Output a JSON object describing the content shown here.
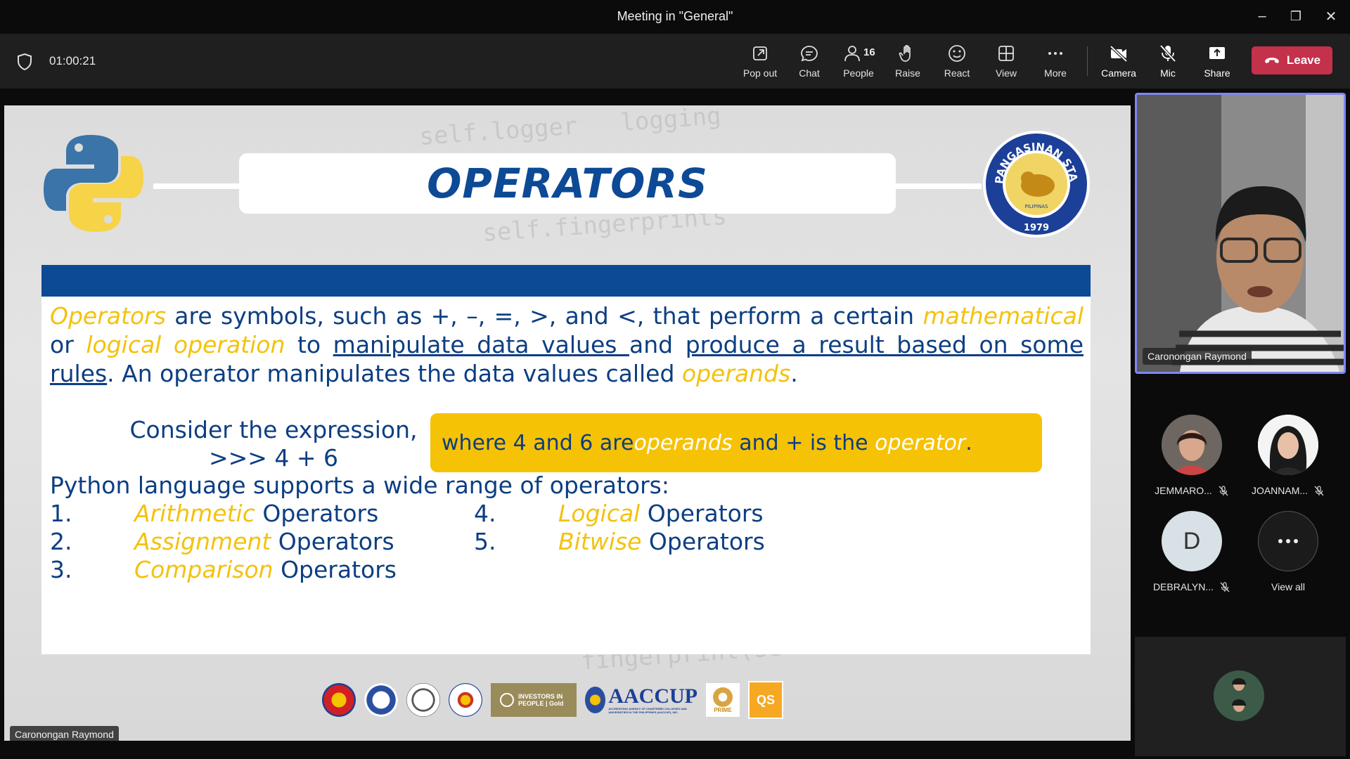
{
  "window": {
    "title": "Meeting in \"General\"",
    "minimize": "–",
    "restore": "❐",
    "close": "✕"
  },
  "toolbar": {
    "timer": "01:00:21",
    "buttons": {
      "popout": "Pop out",
      "chat": "Chat",
      "people": "People",
      "people_count": "16",
      "raise": "Raise",
      "react": "React",
      "view": "View",
      "more": "More",
      "camera": "Camera",
      "mic": "Mic",
      "share": "Share"
    },
    "leave": "Leave",
    "colors": {
      "leave": "#c4314b",
      "background": "#1f1f1f"
    }
  },
  "slide": {
    "title": "OPERATORS",
    "presenter_tag": "Caronongan Raymond",
    "seal_text": "PANGASINAN STATE UNIVERSITY",
    "seal_sub": "PILIPINAS",
    "seal_year": "1979",
    "paragraph": {
      "p1": "Operators",
      "p2": " are symbols, such as +, –, =, >, and <, that perform a certain ",
      "p3": "mathematical",
      "p4": " or ",
      "p5": "logical operation",
      "p6": " to ",
      "p7": "manipulate data values ",
      "p8": "and ",
      "p9": "produce a result based on some rules",
      "p10": ". An operator manipulates the data values called ",
      "p11": "operands",
      "p12": "."
    },
    "consider_line1": "Consider the expression,",
    "consider_line2": ">>> 4 + 6",
    "callout": {
      "c1": "where 4 and 6 are ",
      "c2": "operands",
      "c3": " and + is the ",
      "c4": "operator",
      "c5": "."
    },
    "supports": "Python language supports a wide range of operators:",
    "operators_left": [
      {
        "num": "1.",
        "name": "Arithmetic",
        "suffix": " Operators"
      },
      {
        "num": "2.",
        "name": "Assignment",
        "suffix": " Operators"
      },
      {
        "num": "3.",
        "name": "Comparison",
        "suffix": " Operators"
      }
    ],
    "operators_right": [
      {
        "num": "4.",
        "name": "Logical",
        "suffix": " Operators"
      },
      {
        "num": "5.",
        "name": "Bitwise",
        "suffix": " Operators"
      }
    ],
    "footer_logos": {
      "investors": "INVESTORS IN PEOPLE | Gold",
      "aaccup": "AACCUP",
      "aaccup_sub": "ACCREDITING AGENCY OF CHARTERED COLLEGES AND UNIVERSITIES IN THE PHILIPPINES (AACCUP), INC.",
      "prime": "PRIME",
      "qs": "QS"
    },
    "colors": {
      "blue": "#0c4a96",
      "yellow": "#f4c20d"
    }
  },
  "self_video": {
    "name": "Caronongan Raymond"
  },
  "participants": [
    {
      "name": "JEMMARO...",
      "initial": ""
    },
    {
      "name": "JOANNAM...",
      "initial": ""
    },
    {
      "name": "DEBRALYN...",
      "initial": "D"
    },
    {
      "name": "View all",
      "initial": ""
    }
  ]
}
